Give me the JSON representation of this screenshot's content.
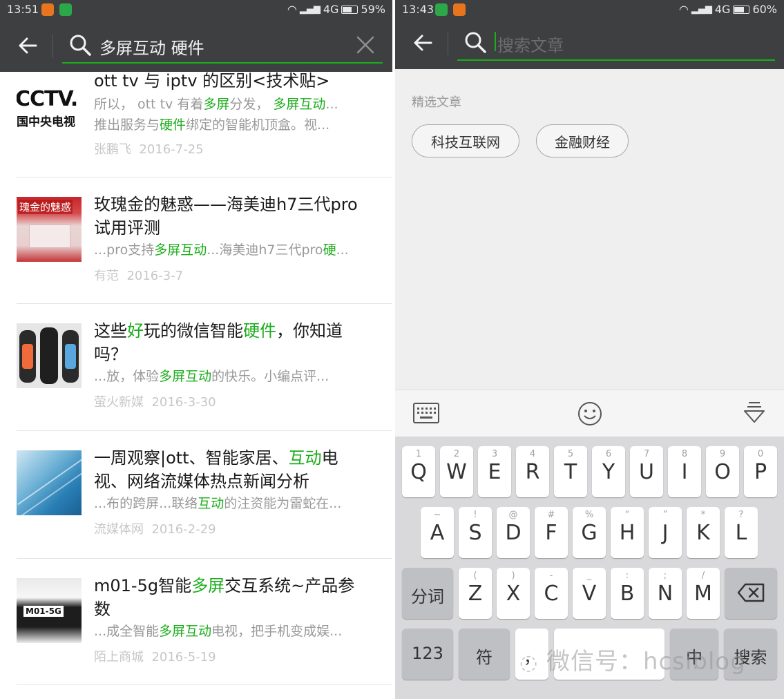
{
  "left": {
    "status": {
      "time": "13:51",
      "network": "4G",
      "battery": "59%",
      "battery_fill": 0.59
    },
    "search": {
      "query": "多屏互动 硬件"
    },
    "results": [
      {
        "title": "ott tv 与 iptv 的区别<技术贴>",
        "title_html": "ott tv 与 iptv 的区别&lt;技术贴&gt;",
        "snippet_html": "所以， ott tv 有着<span class=\"hl\">多屏</span>分发， <span class=\"hl\">多屏互动</span>...",
        "snippet2_html": "推出服务与<span class=\"hl\">硬件</span>绑定的智能机顶盒。视...",
        "author": "张鹏飞",
        "date": "2016-7-25",
        "thumb_text": "CCTV. 国中央电视"
      },
      {
        "title": "玫瑰金的魅惑——海美迪h7三代pro试用评测",
        "title_html": "玫瑰金的魅惑——海美迪h7三代pro\n试用评测",
        "snippet_html": "...pro支持<span class=\"hl\">多屏互动</span>...海美迪h7三代pro<span class=\"hl\">硬</span>...",
        "author": "有范",
        "date": "2016-3-7",
        "thumb_text": "瑰金的魅惑"
      },
      {
        "title": "这些好玩的微信智能硬件，你知道吗？",
        "title_html": "这些<span class=\"hl\">好</span>玩的微信智能<span class=\"hl\">硬件</span>，你知道\n吗？",
        "snippet_html": "...放，体验<span class=\"hl\">多屏互动</span>的快乐。小编点评...",
        "author": "萤火新媒",
        "date": "2016-3-30"
      },
      {
        "title": "一周观察|ott、智能家居、互动电视、网络流媒体热点新闻分析",
        "title_html": "一周观察|ott、智能家居、<span class=\"hl\">互动</span>电\n视、网络流媒体热点新闻分析",
        "snippet_html": "...布的跨屏...联络<span class=\"hl\">互动</span>的注资能为雷蛇在...",
        "author": "流媒体网",
        "date": "2016-2-29"
      },
      {
        "title": "m01-5g智能多屏交互系统~产品参数",
        "title_html": "m01-5g智能<span class=\"hl\">多屏</span>交互系统~产品参\n数",
        "snippet_html": "...成全智能<span class=\"hl\">多屏互动</span>电视，把手机变成娱...",
        "author": "陌上商城",
        "date": "2016-5-19",
        "thumb_text": "M01-5G"
      }
    ]
  },
  "right": {
    "status": {
      "time": "13:43",
      "network": "4G",
      "battery": "60%",
      "battery_fill": 0.6
    },
    "search": {
      "placeholder": "搜索文章"
    },
    "section_label": "精选文章",
    "chips": [
      "科技互联网",
      "金融财经"
    ],
    "keyboard": {
      "row1": [
        [
          "1",
          "Q"
        ],
        [
          "2",
          "W"
        ],
        [
          "3",
          "E"
        ],
        [
          "4",
          "R"
        ],
        [
          "5",
          "T"
        ],
        [
          "6",
          "Y"
        ],
        [
          "7",
          "U"
        ],
        [
          "8",
          "I"
        ],
        [
          "9",
          "O"
        ],
        [
          "0",
          "P"
        ]
      ],
      "row2": [
        [
          "~",
          "A"
        ],
        [
          "!",
          "S"
        ],
        [
          "@",
          "D"
        ],
        [
          "#",
          "F"
        ],
        [
          "%",
          "G"
        ],
        [
          "“",
          "H"
        ],
        [
          "”",
          "J"
        ],
        [
          "*",
          "K"
        ],
        [
          "?",
          "L"
        ]
      ],
      "row3": [
        [
          "(",
          "Z"
        ],
        [
          ")",
          "X"
        ],
        [
          "-",
          "C"
        ],
        [
          "_",
          "V"
        ],
        [
          ":",
          "B"
        ],
        [
          ";",
          "N"
        ],
        [
          "/",
          "M"
        ]
      ],
      "fenci": "分词",
      "num": "123",
      "sym": "符",
      "comma": "，",
      "cn": "中",
      "search": "搜索"
    },
    "watermark": "微信号：hcsiblog"
  },
  "colors": {
    "accent": "#1aad19",
    "navbar": "#3e3f41"
  }
}
